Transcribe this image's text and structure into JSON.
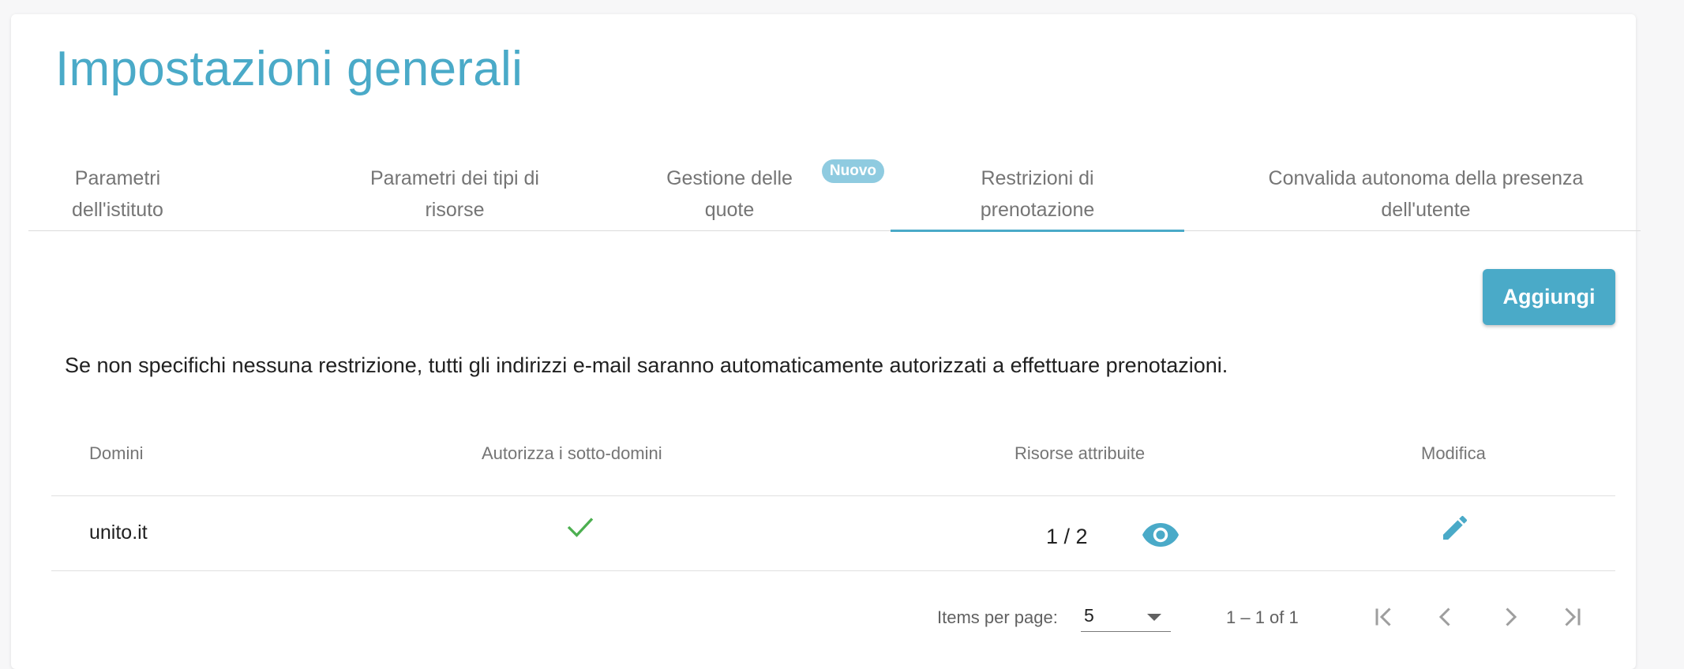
{
  "page": {
    "title": "Impostazioni generali"
  },
  "tabs": [
    {
      "label": "Parametri\ndell'istituto"
    },
    {
      "label": "Parametri dei tipi di\nrisorse"
    },
    {
      "label": "Gestione delle\nquote",
      "badge": "Nuovo"
    },
    {
      "label": "Restrizioni di\nprenotazione",
      "active": true
    },
    {
      "label": "Convalida autonoma della presenza\ndell'utente"
    }
  ],
  "toolbar": {
    "add_label": "Aggiungi"
  },
  "info": {
    "text": "Se non specifichi nessuna restrizione, tutti gli indirizzi e-mail saranno automaticamente autorizzati a effettuare prenotazioni."
  },
  "table": {
    "headers": {
      "domains": "Domini",
      "subdomains": "Autorizza i sotto-domini",
      "resources": "Risorse attribuite",
      "edit": "Modifica"
    },
    "rows": [
      {
        "domain": "unito.it",
        "subdomains_allowed": true,
        "resources": "1 / 2"
      }
    ]
  },
  "paginator": {
    "items_per_page_label": "Items per page:",
    "items_per_page": "5",
    "range": "1 – 1 of 1"
  },
  "colors": {
    "accent": "#4aaac8",
    "badge": "#8fcbe0",
    "check": "#4caf50",
    "disabled": "#9e9e9e"
  },
  "icons": [
    "check-icon",
    "eye-icon",
    "pencil-icon",
    "first-page-icon",
    "chevron-left-icon",
    "chevron-right-icon",
    "last-page-icon"
  ]
}
